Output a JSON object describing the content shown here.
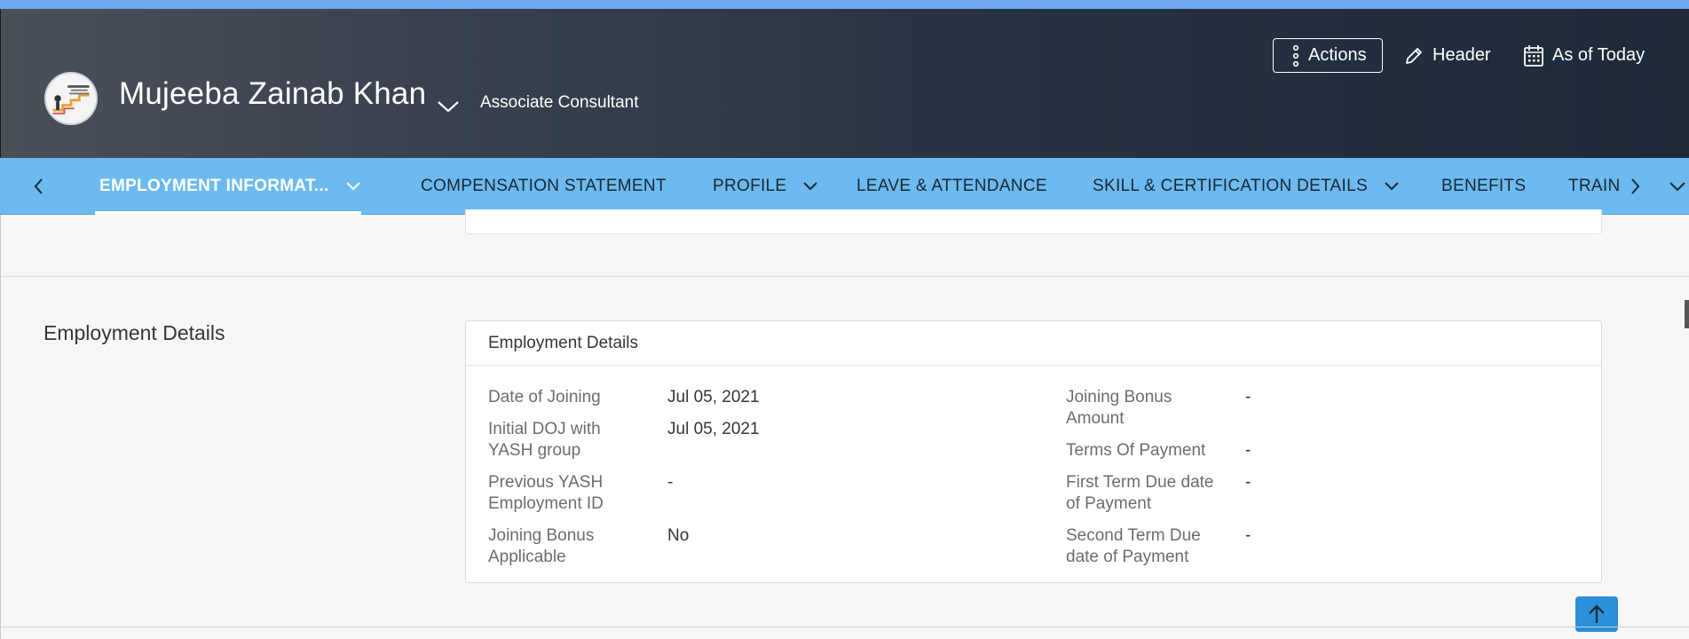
{
  "header": {
    "employee_name": "Mujeeba Zainab Khan",
    "job_title": "Associate Consultant",
    "actions_label": "Actions",
    "header_label": "Header",
    "as_of_label": "As of Today"
  },
  "tabs": [
    {
      "label": "EMPLOYMENT INFORMAT..."
    },
    {
      "label": "COMPENSATION STATEMENT"
    },
    {
      "label": "PROFILE"
    },
    {
      "label": "LEAVE & ATTENDANCE"
    },
    {
      "label": "SKILL & CERTIFICATION DETAILS"
    },
    {
      "label": "BENEFITS"
    },
    {
      "label": "TRAIN"
    }
  ],
  "section": {
    "title": "Employment Details",
    "card_title": "Employment Details",
    "left_fields": [
      {
        "label": "Date of Joining",
        "value": "Jul 05, 2021"
      },
      {
        "label": "Initial DOJ with YASH group",
        "value": "Jul 05, 2021"
      },
      {
        "label": "Previous YASH Employment ID",
        "value": "-"
      },
      {
        "label": "Joining Bonus Applicable",
        "value": "No"
      }
    ],
    "right_fields": [
      {
        "label": "Joining Bonus Amount",
        "value": "-"
      },
      {
        "label": "Terms Of Payment",
        "value": "-"
      },
      {
        "label": "First Term Due date of Payment",
        "value": "-"
      },
      {
        "label": "Second Term Due date of Payment",
        "value": "-"
      }
    ]
  },
  "colors": {
    "top_strip": "#6fa8ec",
    "tabbar": "#6cbaf0",
    "scroll_button": "#2b90d9"
  },
  "icons": [
    "overflow-vertical-icon",
    "edit-pencil-icon",
    "calendar-icon",
    "chevron-down-icon",
    "chevron-left-icon",
    "chevron-right-icon",
    "arrow-up-icon"
  ]
}
